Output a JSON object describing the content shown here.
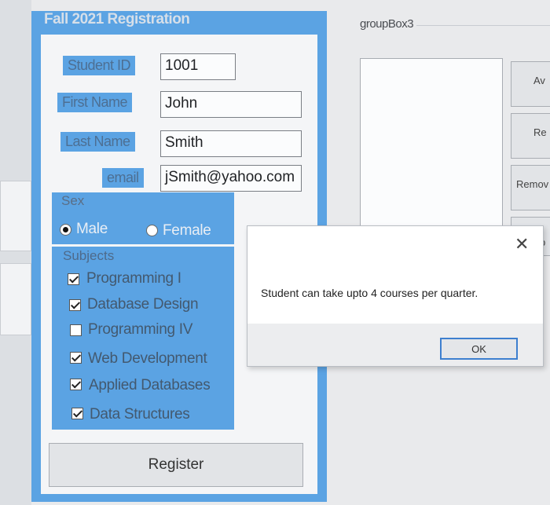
{
  "registration": {
    "title": "Fall 2021 Registration",
    "labels": {
      "student_id": "Student ID",
      "first_name": "First Name",
      "last_name": "Last Name",
      "email": "email"
    },
    "values": {
      "student_id": "1001",
      "first_name": "John",
      "last_name": "Smith",
      "email": "jSmith@yahoo.com"
    },
    "sex": {
      "title": "Sex",
      "options": [
        "Male",
        "Female"
      ],
      "selected": "Male"
    },
    "subjects": {
      "title": "Subjects",
      "items": [
        {
          "label": "Programming I",
          "checked": true
        },
        {
          "label": "Database Design",
          "checked": true
        },
        {
          "label": "Programming IV",
          "checked": false
        },
        {
          "label": "Web Development",
          "checked": true
        },
        {
          "label": "Applied Databases",
          "checked": true
        },
        {
          "label": "Data Structures",
          "checked": true
        }
      ]
    },
    "register_label": "Register"
  },
  "groupbox3": {
    "title": "groupBox3",
    "buttons": [
      "Av",
      "Re",
      "Remov",
      "p"
    ]
  },
  "dialog": {
    "message": "Student can take upto 4 courses per quarter.",
    "ok_label": "OK",
    "close_glyph": "✕"
  },
  "colors": {
    "panel_blue": "#5ba3e3",
    "dialog_focus": "#3d7fcf"
  }
}
